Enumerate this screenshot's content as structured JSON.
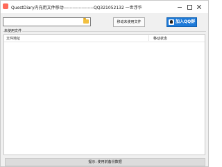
{
  "window": {
    "title": "QuestDiary内充用文件移动--------------------QQ321052132 一世浮华"
  },
  "toolbar": {
    "path_value": "",
    "move_button_label": "移动未使用文件",
    "qq_button_label": "加入QQ群"
  },
  "group": {
    "label": "未使用文件"
  },
  "list": {
    "columns": [
      "文件地址",
      "移动状态"
    ],
    "rows": []
  },
  "status": {
    "text": "提示: 使用前备份数据"
  }
}
